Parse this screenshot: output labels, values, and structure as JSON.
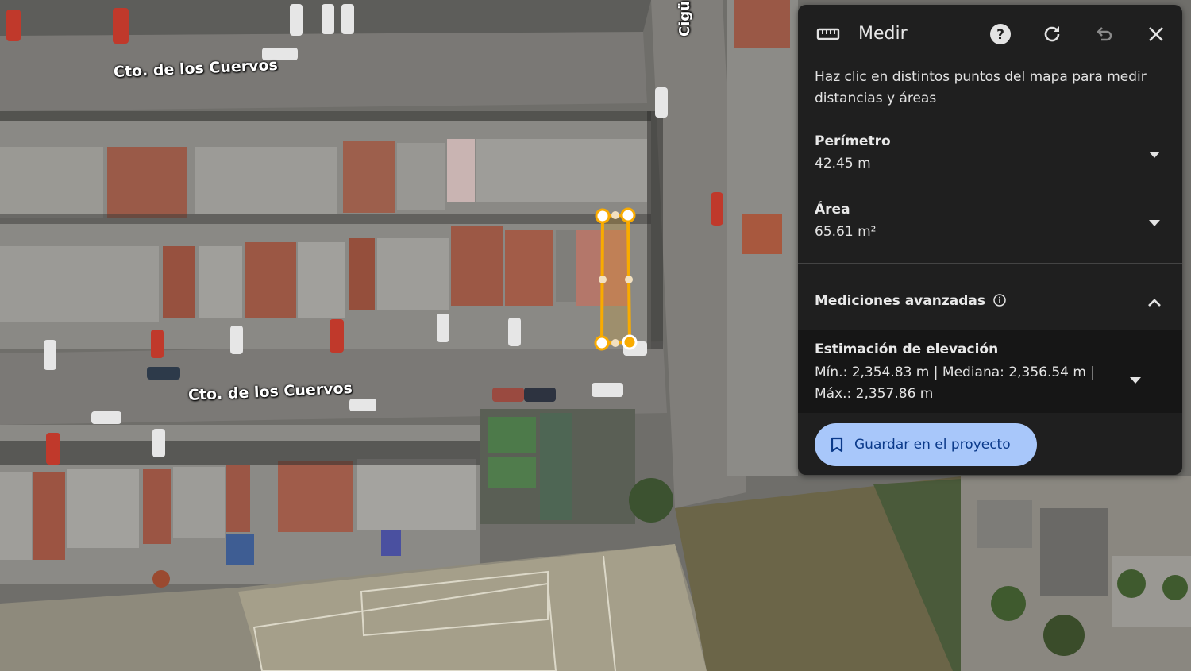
{
  "map": {
    "street_labels": [
      "Cto. de los Cuervos",
      "Cto. de los Cuervos",
      "Cigü"
    ]
  },
  "panel": {
    "title": "Medir",
    "icons": [
      "ruler-icon",
      "help-icon",
      "refresh-icon",
      "undo-icon",
      "close-icon"
    ],
    "instructions": "Haz clic en distintos puntos del mapa para medir distancias y áreas",
    "perimeter": {
      "label": "Perímetro",
      "value": "42.45 m"
    },
    "area": {
      "label": "Área",
      "value": "65.61 m²"
    },
    "advanced": {
      "label": "Mediciones avanzadas"
    },
    "elevation": {
      "label": "Estimación de elevación",
      "value": "Mín.: 2,354.83 m | Mediana: 2,356.54 m | Máx.: 2,357.86 m"
    },
    "save_button": "Guardar en el proyecto"
  },
  "colors": {
    "panel_bg": "#1f1f1f",
    "measure_line": "#f9ab00",
    "save_button_bg": "#a8c7fa"
  }
}
